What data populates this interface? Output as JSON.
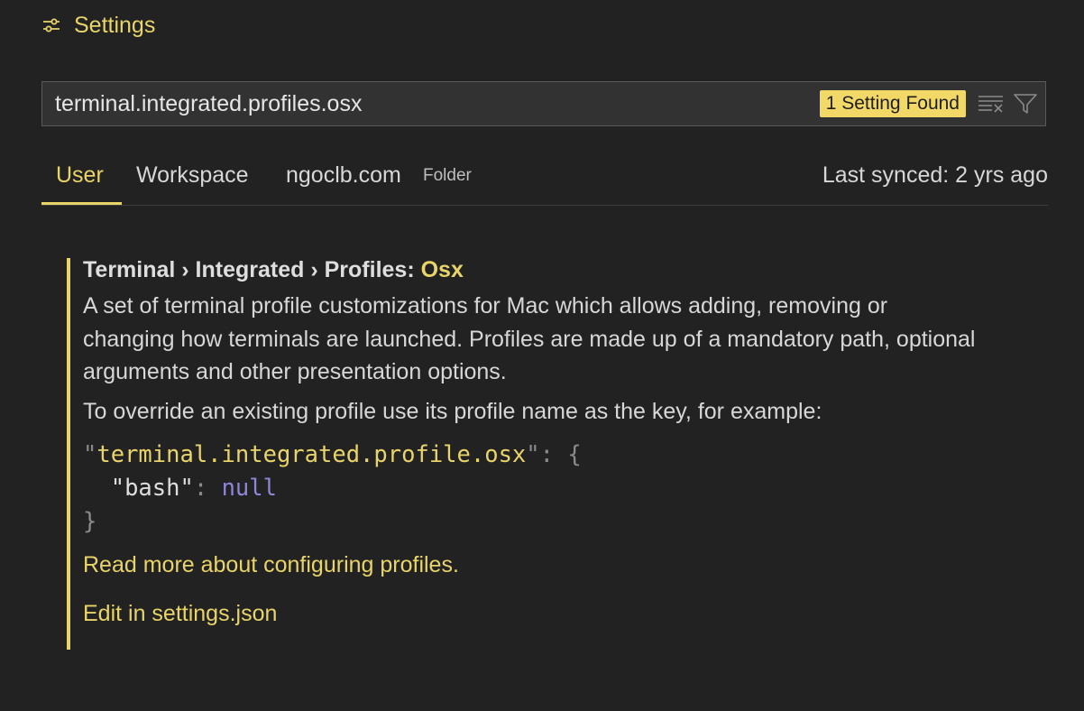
{
  "header": {
    "title": "Settings",
    "icon": "settings-sliders-icon"
  },
  "search": {
    "value": "terminal.integrated.profiles.osx",
    "result_badge": "1 Setting Found",
    "clear_icon": "clear-filter-icon",
    "filter_icon": "filter-icon"
  },
  "tabs": [
    {
      "label": "User",
      "active": true
    },
    {
      "label": "Workspace",
      "active": false
    },
    {
      "label": "ngoclb.com",
      "active": false,
      "tag": "Folder"
    }
  ],
  "sync_status": "Last synced: 2 yrs ago",
  "setting": {
    "breadcrumb": "Terminal › Integrated › Profiles: ",
    "key": "Osx",
    "description": "A set of terminal profile customizations for Mac which allows adding, removing or changing how terminals are launched. Profiles are made up of a mandatory path, optional arguments and other presentation options.",
    "override_text": "To override an existing profile use its profile name as the key, for example:",
    "code": {
      "q1": "\"",
      "prop": "terminal.integrated.profile.osx",
      "q2": "\"",
      "colon_brace": ": {",
      "indent": "  ",
      "inner_key": "\"bash\"",
      "inner_colon": ": ",
      "inner_value": "null",
      "close": "}"
    },
    "read_more_link": "Read more about configuring profiles.",
    "edit_link": "Edit in settings.json"
  },
  "colors": {
    "background": "#222222",
    "accent": "#e8d468",
    "badge": "#f2d867",
    "null_keyword": "#8c87d8"
  }
}
